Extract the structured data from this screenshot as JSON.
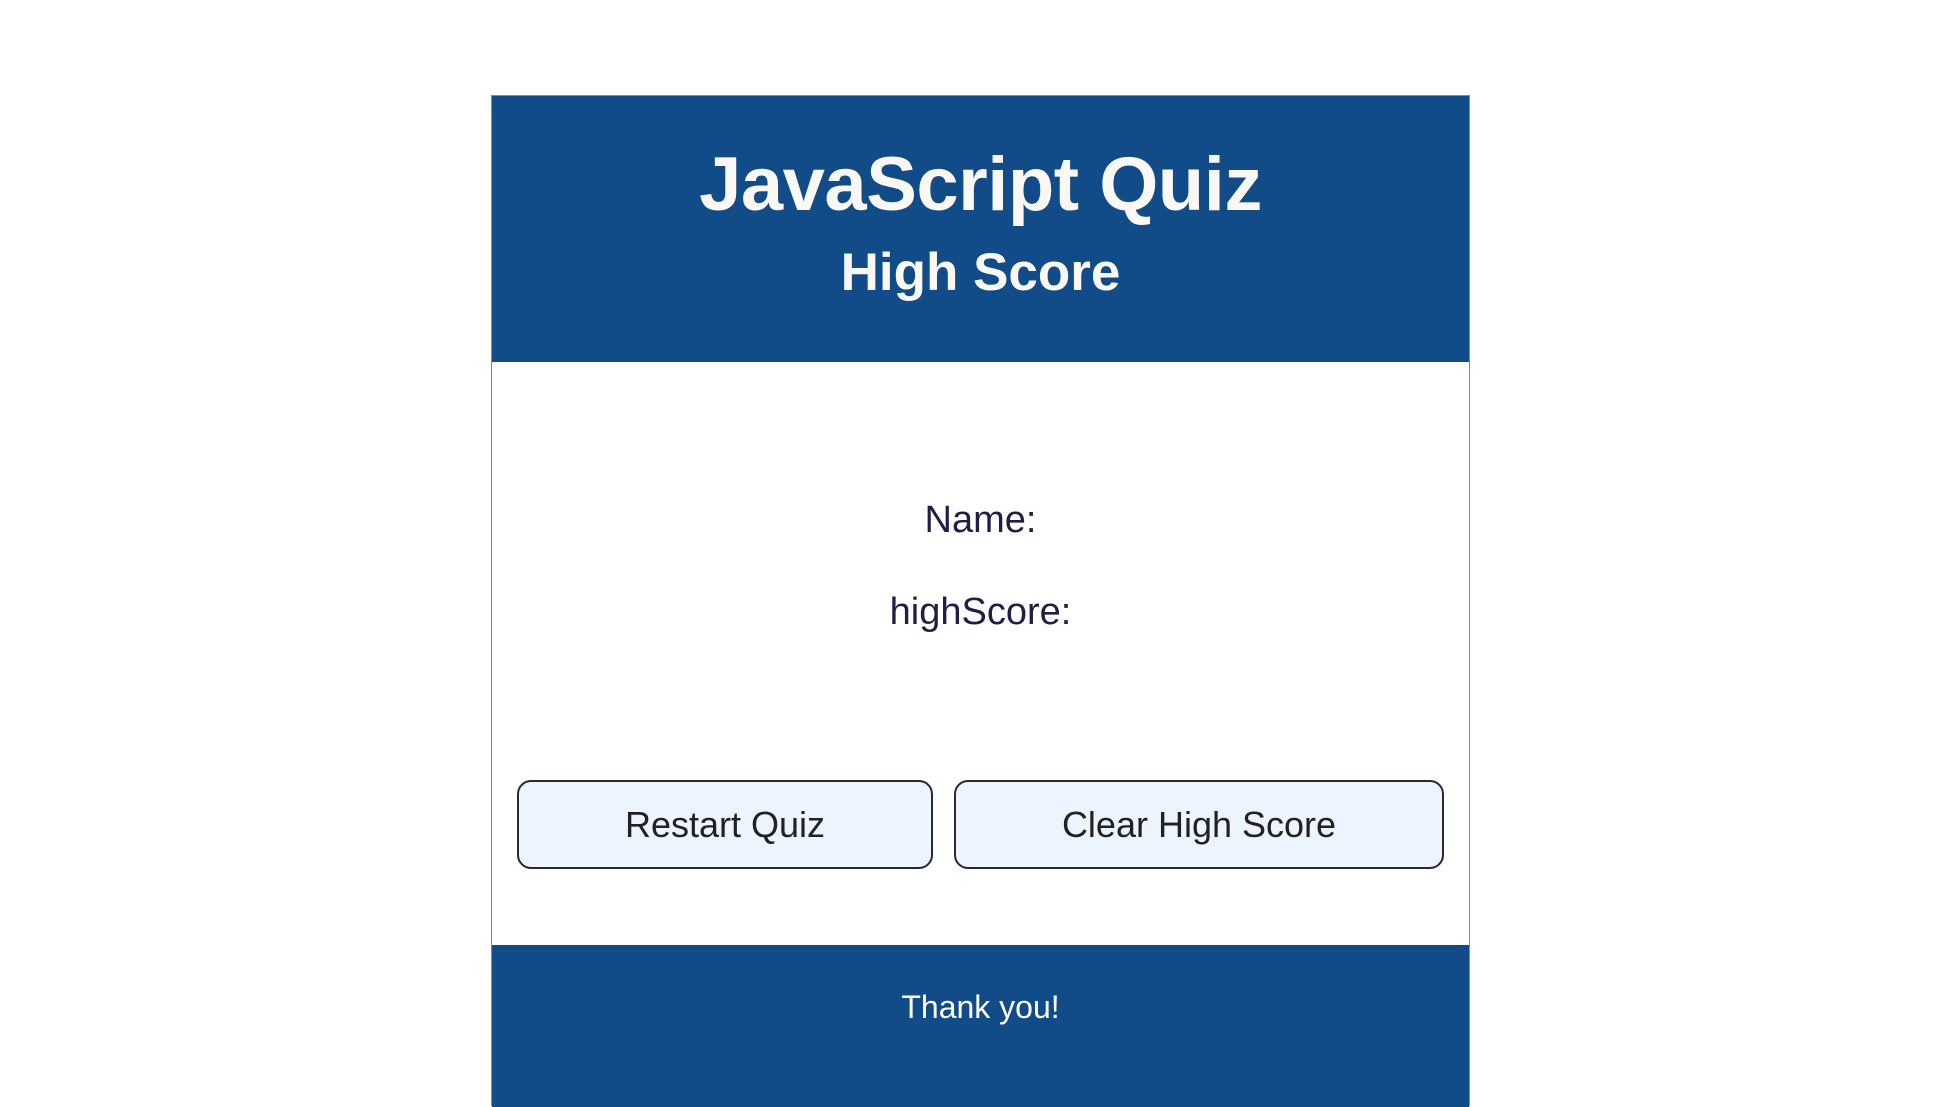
{
  "header": {
    "title": "JavaScript Quiz",
    "subtitle": "High Score"
  },
  "result": {
    "name_label": "Name:",
    "score_label": "highScore:"
  },
  "buttons": {
    "restart_label": "Restart Quiz",
    "clear_label": "Clear High Score"
  },
  "footer": {
    "text": "Thank you!"
  },
  "colors": {
    "header_bg": "#114b88",
    "button_bg": "#ecf4fe",
    "text_dark": "#1f1f45"
  }
}
